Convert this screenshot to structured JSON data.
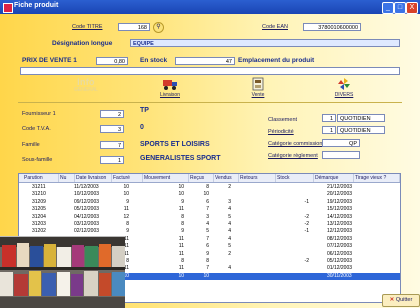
{
  "window": {
    "title": "Fiche produit",
    "buttons": [
      "_",
      "□",
      "X"
    ]
  },
  "header": {
    "code_titre_label": "Code TITRE",
    "code_titre_value": "168",
    "code_ean_label": "Code EAN",
    "code_ean_value": "3780010600000",
    "designation_label": "Désignation longue",
    "designation_value": "EQUIPE"
  },
  "prix": {
    "prix_label": "PRIX DE VENTE 1",
    "prix_value": "0,80",
    "stock_label": "En stock",
    "stock_value": "47",
    "emplacement_label": "Emplacement du produit",
    "emplacement_value": ""
  },
  "toolbar": {
    "info_label": "Info",
    "general_label": "GÉNÉRAL",
    "livraison_label": "Livraison",
    "vente_label": "Vente",
    "divers_label": "DIVERS"
  },
  "left_fields": {
    "fournisseur_label": "Fournisseur 1",
    "fournisseur_value": "2",
    "fournisseur_name": "TP",
    "tva_label": "Code T.V.A.",
    "tva_value": "3",
    "tva_name": "0",
    "famille_label": "Famille",
    "famille_value": "7",
    "famille_name": "SPORTS ET LOISIRS",
    "sous_famille_label": "Sous-famille",
    "sous_famille_value": "1",
    "sous_famille_name": "GENERALISTES SPORT"
  },
  "right_fields": {
    "classement_label": "Classement",
    "classement_num": "1",
    "classement_value": "QUOTIDIEN",
    "periodicite_label": "Périodicité",
    "periodicite_num": "1",
    "periodicite_value": "QUOTIDIEN",
    "commission_label": "Catégorie commission",
    "commission_value": "QP",
    "reglement_label": "Catégorie règlement",
    "reglement_value": ""
  },
  "grid": {
    "columns": [
      "Parution",
      "Nu",
      "Date livraison",
      "Facturé",
      "Mouvement",
      "Reçus",
      "Vendus",
      "Retours",
      "Stock",
      "Démarque",
      "Tirage vieux ?"
    ],
    "rows": [
      [
        "31211",
        "11/12/2003",
        "10",
        "10",
        "8",
        "2",
        "",
        "",
        "21/12/2003"
      ],
      [
        "31210",
        "10/12/2003",
        "10",
        "10",
        "10",
        "",
        "",
        "",
        "20/12/2003"
      ],
      [
        "31209",
        "09/12/2003",
        "9",
        "9",
        "6",
        "3",
        "",
        "-1",
        "19/12/2003"
      ],
      [
        "31205",
        "05/12/2003",
        "11",
        "11",
        "7",
        "4",
        "",
        "",
        "15/12/2003"
      ],
      [
        "31204",
        "04/12/2003",
        "12",
        "8",
        "3",
        "5",
        "",
        "-2",
        "14/12/2003"
      ],
      [
        "31203",
        "03/12/2003",
        "8",
        "8",
        "4",
        "4",
        "",
        "-2",
        "13/12/2003"
      ],
      [
        "31202",
        "02/12/2003",
        "9",
        "9",
        "5",
        "4",
        "",
        "-1",
        "12/12/2003"
      ],
      [
        "31129",
        "29/11/2003",
        "11",
        "11",
        "7",
        "4",
        "",
        "",
        "08/12/2003"
      ],
      [
        "",
        "",
        "11",
        "11",
        "6",
        "5",
        "",
        "",
        "07/12/2003"
      ],
      [
        "",
        "",
        "11",
        "11",
        "9",
        "2",
        "",
        "",
        "06/12/2003"
      ],
      [
        "",
        "",
        "8",
        "8",
        "8",
        "",
        "",
        "-2",
        "05/12/2003"
      ],
      [
        "",
        "",
        "11",
        "11",
        "7",
        "4",
        "",
        "",
        "01/12/2003"
      ],
      [
        "",
        "",
        "10",
        "10",
        "10",
        "",
        "",
        "",
        "30/11/2003"
      ]
    ]
  },
  "footer": {
    "quit_label": "Quitter"
  },
  "colors": {
    "accent": "#2e66d8",
    "background": "#ffd64a",
    "title_bar": "#2b5fd0"
  }
}
